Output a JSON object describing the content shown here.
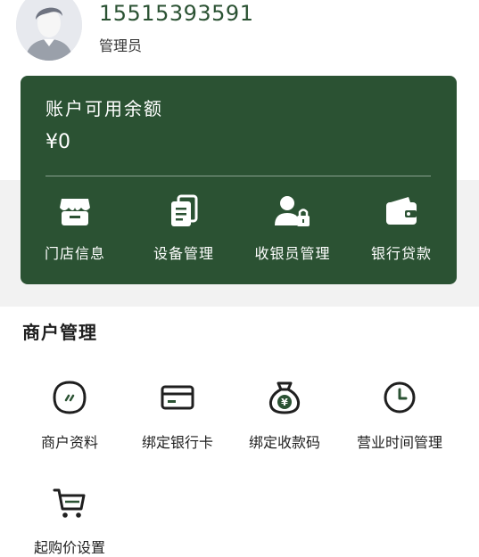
{
  "profile": {
    "phone": "15515393591",
    "role": "管理员",
    "avatar_icon": "user-avatar-icon"
  },
  "balance_card": {
    "title": "账户可用余额",
    "amount": "¥0",
    "background_color": "#2b5233",
    "actions": [
      {
        "label": "门店信息",
        "icon": "store-icon"
      },
      {
        "label": "设备管理",
        "icon": "device-doc-icon"
      },
      {
        "label": "收银员管理",
        "icon": "cashier-lock-icon"
      },
      {
        "label": "银行贷款",
        "icon": "wallet-icon"
      }
    ]
  },
  "merchant_section": {
    "title": "商户管理",
    "items": [
      {
        "label": "商户资料",
        "icon": "profile-badge-icon"
      },
      {
        "label": "绑定银行卡",
        "icon": "bank-card-icon"
      },
      {
        "label": "绑定收款码",
        "icon": "money-bag-icon"
      },
      {
        "label": "营业时间管理",
        "icon": "clock-icon"
      },
      {
        "label": "起购价设置",
        "icon": "cart-icon"
      }
    ]
  }
}
